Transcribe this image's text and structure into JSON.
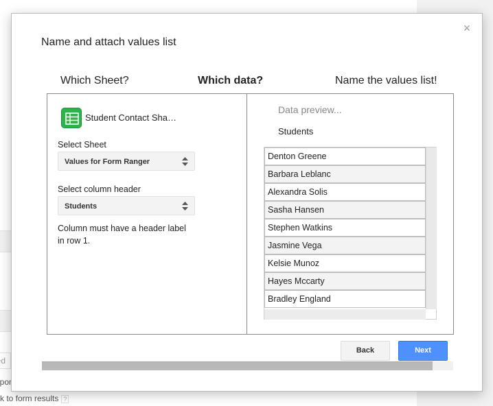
{
  "background": {
    "field_partial": "led",
    "resp_partial": "responses",
    "link_text": "k to form results",
    "help_icon": "?"
  },
  "dialog": {
    "title": "Name and attach values list",
    "close_glyph": "×",
    "steps": [
      "Which Sheet?",
      "Which data?",
      "Name the values list!"
    ],
    "active_step": 1
  },
  "left_panel": {
    "spreadsheet_icon": "spreadsheet-icon",
    "spreadsheet_name": "Student Contact Sha…",
    "select_sheet_label": "Select Sheet",
    "select_sheet_value": "Values for Form Ranger",
    "select_column_label": "Select column header",
    "select_column_value": "Students",
    "help_text": "Column must have a header label in row 1."
  },
  "right_panel": {
    "preview_label": "Data preview...",
    "column_header": "Students",
    "rows": [
      "Denton Greene",
      "Barbara Leblanc",
      "Alexandra Solis",
      "Sasha Hansen",
      "Stephen Watkins",
      "Jasmine Vega",
      "Kelsie Munoz",
      "Hayes Mccarty",
      "Bradley England"
    ]
  },
  "buttons": {
    "back": "Back",
    "next": "Next"
  },
  "progress": {
    "fraction": 0.95
  },
  "colors": {
    "primary_button": "#4d90fe",
    "sheets_icon": "#2bb44a"
  }
}
